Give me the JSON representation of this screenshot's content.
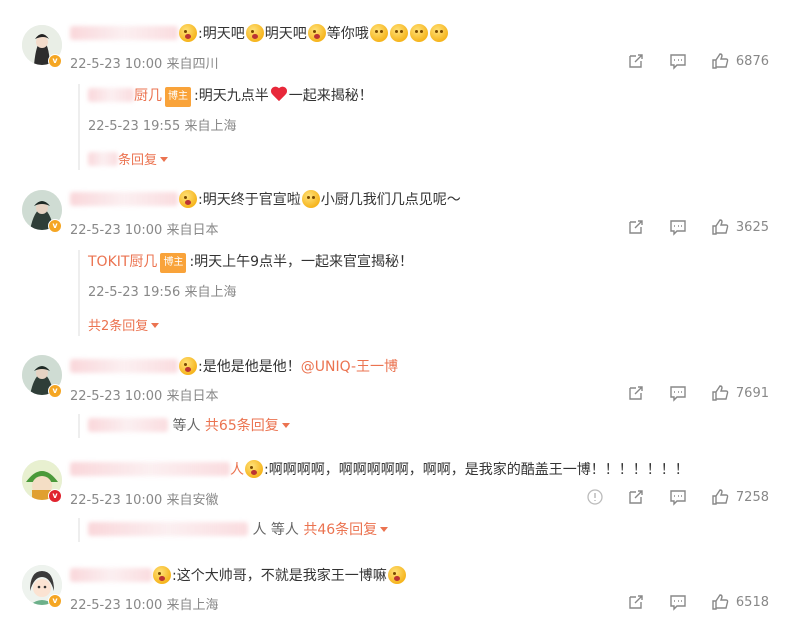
{
  "comments": [
    {
      "text_tail": ":明天吧",
      "text_mid": "明天吧",
      "text_end": "等你哦",
      "date": "22-5-23 10:00 来自四川",
      "likes": "6876",
      "reply": {
        "author_visible": "厨几",
        "tag": "博主",
        "text": ":明天九点半",
        "text_end": "一起来揭秘！",
        "date": "22-5-23 19:55 来自上海",
        "more": "条回复"
      }
    },
    {
      "text_tail": ":明天终于官宣啦",
      "text_end": "小厨几我们几点见呢～",
      "date": "22-5-23 10:00 来自日本",
      "likes": "3625",
      "reply": {
        "author": "TOKIT厨几",
        "tag": "博主",
        "text": ":明天上午9点半，一起来官宣揭秘！",
        "date": "22-5-23 19:56 来自上海",
        "more": "共2条回复"
      }
    },
    {
      "text_tail": ":是他是他是他！",
      "mention": "@UNIQ-王一博",
      "date": "22-5-23 10:00 来自日本",
      "likes": "7691",
      "sub": {
        "suffix": "等人",
        "more": "共65条回复"
      }
    },
    {
      "text_tail": ":啊啊啊啊，啊啊啊啊啊，啊啊，是我家的酷盖王一博！！！！！！！",
      "name_fragment": "人",
      "date": "22-5-23 10:00 来自安徽",
      "likes": "7258",
      "sub": {
        "suffix": "人 等人",
        "more": "共46条回复"
      }
    },
    {
      "text_tail": ":这个大帅哥，不就是我家王一博嘛",
      "date": "22-5-23 10:00 来自上海",
      "likes": "6518"
    }
  ],
  "colors": {
    "accent": "#eb7350",
    "tag": "#f9a33a",
    "meta": "#888888"
  },
  "icons": [
    "share-icon",
    "comment-icon",
    "like-icon",
    "report-icon"
  ]
}
